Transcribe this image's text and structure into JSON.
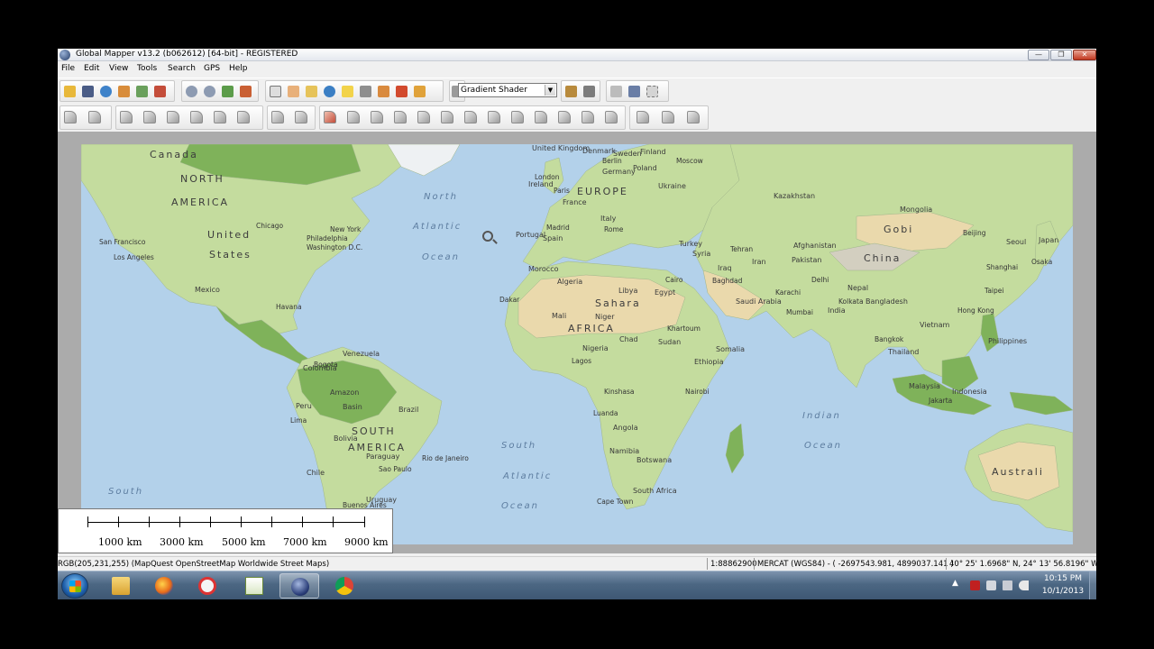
{
  "window": {
    "title": "Global Mapper v13.2 (b062612) [64-bit] - REGISTERED",
    "min_glyph": "—",
    "max_glyph": "❐",
    "close_glyph": "✕"
  },
  "menu": [
    "File",
    "Edit",
    "View",
    "Tools",
    "Search",
    "GPS",
    "Help"
  ],
  "toolbar": {
    "shader_selected": "Gradient Shader",
    "dropdown_arrow": "▼"
  },
  "colors": {
    "ocean": "#b3d1ea",
    "land": "#c4dc9e",
    "forest": "#7fb25a",
    "desert": "#ead9ac",
    "mountain": "#d3cfc0",
    "ice": "#eef1f3"
  },
  "map": {
    "continents": [
      "NORTH",
      "AMERICA",
      "SOUTH",
      "AMERICA",
      "AFRICA",
      "EUROPE",
      "China",
      "Australi"
    ],
    "oceans": [
      "North",
      "Atlantic",
      "Ocean",
      "South",
      "Atlantic",
      "Ocean",
      "Indian",
      "Ocean",
      "South"
    ],
    "regions": [
      "Canada",
      "United",
      "States",
      "Sahara",
      "Amazon",
      "Basin",
      "Gobi",
      "Kazakhstan",
      "Mongolia"
    ],
    "countries": [
      "Mexico",
      "Algeria",
      "Libya",
      "Egypt",
      "Mali",
      "Niger",
      "Chad",
      "Sudan",
      "Nigeria",
      "Ethiopia",
      "Somalia",
      "Angola",
      "Namibia",
      "Botswana",
      "South Africa",
      "Saudi Arabia",
      "Iran",
      "Iraq",
      "Syria",
      "Turkey",
      "Spain",
      "France",
      "Italy",
      "Germany",
      "Poland",
      "Ukraine",
      "Finland",
      "Sweden",
      "India",
      "Pakistan",
      "Afghanistan",
      "Japan",
      "Seoul",
      "Bolivia",
      "Brazil",
      "Paraguay",
      "Chile",
      "Peru",
      "Uruguay",
      "Colombia",
      "Venezuela",
      "Thailand",
      "Indonesia",
      "Malaysia",
      "Philippines",
      "Vietnam",
      "Bangladesh",
      "Nepal",
      "Morocco",
      "Portugal",
      "United Kingdom",
      "Ireland",
      "Denmark"
    ],
    "cities": [
      "San Francisco",
      "Los Angeles",
      "Chicago",
      "New York",
      "Philadelphia",
      "Washington D.C.",
      "Havana",
      "Bogota",
      "Lima",
      "Sao Paulo",
      "Rio de Janeiro",
      "Buenos Aires",
      "London",
      "Paris",
      "Berlin",
      "Moscow",
      "Madrid",
      "Rome",
      "Cairo",
      "Tehran",
      "Baghdad",
      "Karachi",
      "Delhi",
      "Mumbai",
      "Kolkata",
      "Bangkok",
      "Beijing",
      "Shanghai",
      "Osaka",
      "Taipei",
      "Hong Kong",
      "Jakarta",
      "Kinshasa",
      "Lagos",
      "Nairobi",
      "Cape Town",
      "Dakar",
      "Khartoum",
      "Luanda"
    ]
  },
  "scale": {
    "labels": [
      "1000 km",
      "3000 km",
      "5000 km",
      "7000 km",
      "9000 km"
    ]
  },
  "status": {
    "pixel": "RGB(205,231,255) (MapQuest OpenStreetMap Worldwide Street Maps)",
    "ratio": "1:88862900",
    "projection": "MERCAT (WGS84) - ( -2697543.981, 4899037.141 )",
    "coords": "40° 25' 1.6968\" N, 24° 13' 56.8196\" W"
  },
  "taskbar": {
    "time": "10:15 PM",
    "date": "10/1/2013"
  }
}
